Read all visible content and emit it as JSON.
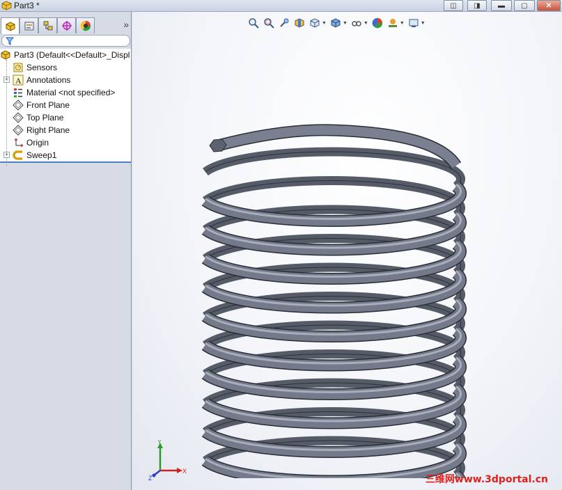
{
  "window": {
    "title": "Part3 *"
  },
  "feature_manager": {
    "tabs": [
      {
        "name": "feature-tree",
        "icon": "part-icon"
      },
      {
        "name": "property-manager",
        "icon": "property-icon"
      },
      {
        "name": "configuration-manager",
        "icon": "config-icon"
      },
      {
        "name": "dimxpert-manager",
        "icon": "target-icon"
      },
      {
        "name": "display-manager",
        "icon": "appearance-icon"
      }
    ],
    "expand_label": "»",
    "tree": {
      "root": "Part3  (Default<<Default>_Displ",
      "items": [
        {
          "label": "Sensors",
          "icon": "sensor-icon",
          "expandable": false
        },
        {
          "label": "Annotations",
          "icon": "annotation-icon",
          "expandable": true
        },
        {
          "label": "Material <not specified>",
          "icon": "material-icon",
          "expandable": false
        },
        {
          "label": "Front Plane",
          "icon": "plane-icon",
          "expandable": false
        },
        {
          "label": "Top Plane",
          "icon": "plane-icon",
          "expandable": false
        },
        {
          "label": "Right Plane",
          "icon": "plane-icon",
          "expandable": false
        },
        {
          "label": "Origin",
          "icon": "origin-icon",
          "expandable": false
        },
        {
          "label": "Sweep1",
          "icon": "sweep-icon",
          "expandable": true
        }
      ]
    }
  },
  "view_toolbar": [
    "zoom-to-fit-icon",
    "zoom-to-area-icon",
    "previous-view-icon",
    "section-view-icon",
    "view-orientation-icon",
    "display-style-icon",
    "hide-show-icon",
    "edit-appearance-icon",
    "apply-scene-icon",
    "view-settings-icon"
  ],
  "triad": {
    "y": "Y",
    "x": "X",
    "z": "Z"
  },
  "watermark": "三维网www.3dportal.cn",
  "colors": {
    "spring": "#6f7586",
    "accent": "#4c7fc4",
    "watermark": "#e0201c"
  }
}
